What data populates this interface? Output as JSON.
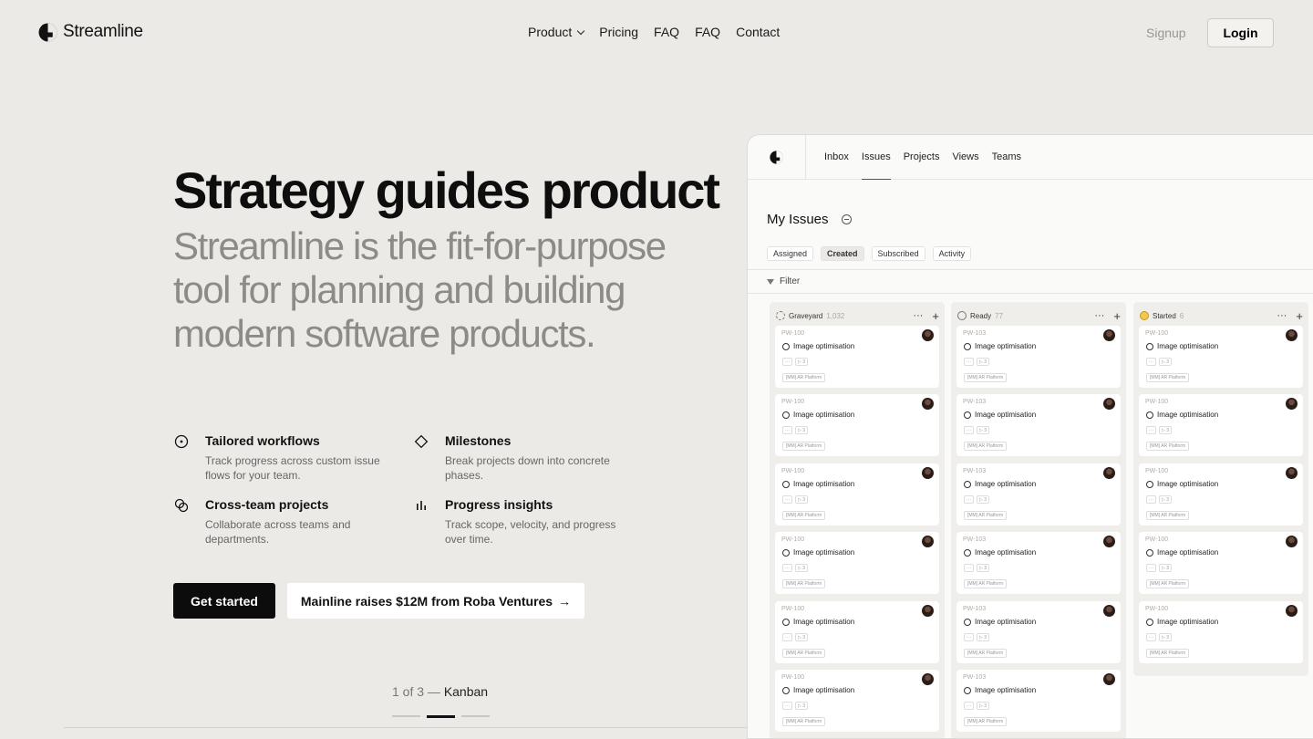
{
  "brand": {
    "name": "Streamline"
  },
  "nav": {
    "links": [
      {
        "label": "Product",
        "has_dropdown": true
      },
      {
        "label": "Pricing"
      },
      {
        "label": "FAQ"
      },
      {
        "label": "FAQ"
      },
      {
        "label": "Contact"
      }
    ],
    "signup": "Signup",
    "login": "Login"
  },
  "hero": {
    "title": "Strategy guides product",
    "subtitle": "Streamline is the fit-for-purpose tool for planning and building modern software products."
  },
  "features": [
    {
      "icon": "target-icon",
      "title": "Tailored workflows",
      "desc": "Track progress across custom issue flows for your team."
    },
    {
      "icon": "diamond-icon",
      "title": "Milestones",
      "desc": "Break projects down into concrete phases."
    },
    {
      "icon": "overlap-circles-icon",
      "title": "Cross-team projects",
      "desc": "Collaborate across teams and departments."
    },
    {
      "icon": "bar-chart-icon",
      "title": "Progress insights",
      "desc": "Track scope, velocity, and progress over time."
    }
  ],
  "cta": {
    "primary": "Get started",
    "secondary": "Mainline raises $12M from Roba Ventures",
    "secondary_arrow": "→"
  },
  "slider": {
    "position": "1 of 3 —",
    "label": "Kanban",
    "total": 3,
    "active_index": 1
  },
  "app": {
    "tabs": [
      "Inbox",
      "Issues",
      "Projects",
      "Views",
      "Teams"
    ],
    "active_tab": "Issues",
    "page_title": "My Issues",
    "subtabs": [
      "Assigned",
      "Created",
      "Subscribed",
      "Activity"
    ],
    "active_subtab": "Created",
    "filter_label": "Filter",
    "columns": [
      {
        "name": "Graveyard",
        "count": "1,032",
        "status": "dashed",
        "cards": [
          {
            "id": "PW-100",
            "title": "Image optimisation",
            "tag": "[MM] AR Platform"
          },
          {
            "id": "PW-100",
            "title": "Image optimisation",
            "tag": "[MM] AR Platform"
          },
          {
            "id": "PW-100",
            "title": "Image optimisation",
            "tag": "[MM] AR Platform"
          },
          {
            "id": "PW-100",
            "title": "Image optimisation",
            "tag": "[MM] AR Platform"
          },
          {
            "id": "PW-100",
            "title": "Image optimisation",
            "tag": "[MM] AR Platform"
          },
          {
            "id": "PW-100",
            "title": "Image optimisation",
            "tag": "[MM] AR Platform"
          }
        ]
      },
      {
        "name": "Ready",
        "count": "77",
        "status": "ring",
        "cards": [
          {
            "id": "PW-103",
            "title": "Image optimisation",
            "tag": "[MM] AR Platform"
          },
          {
            "id": "PW-103",
            "title": "Image optimisation",
            "tag": "[MM] AR Platform"
          },
          {
            "id": "PW-103",
            "title": "Image optimisation",
            "tag": "[MM] AR Platform"
          },
          {
            "id": "PW-103",
            "title": "Image optimisation",
            "tag": "[MM] AR Platform"
          },
          {
            "id": "PW-103",
            "title": "Image optimisation",
            "tag": "[MM] AR Platform"
          },
          {
            "id": "PW-103",
            "title": "Image optimisation",
            "tag": "[MM] AR Platform"
          }
        ]
      },
      {
        "name": "Started",
        "count": "6",
        "status": "yellow",
        "cards": [
          {
            "id": "PW-100",
            "title": "Image optimisation",
            "tag": "[MM] AR Platform"
          },
          {
            "id": "PW-100",
            "title": "Image optimisation",
            "tag": "[MM] AR Platform"
          },
          {
            "id": "PW-100",
            "title": "Image optimisation",
            "tag": "[MM] AR Platform"
          },
          {
            "id": "PW-100",
            "title": "Image optimisation",
            "tag": "[MM] AR Platform"
          },
          {
            "id": "PW-100",
            "title": "Image optimisation",
            "tag": "[MM] AR Platform"
          }
        ]
      }
    ]
  }
}
